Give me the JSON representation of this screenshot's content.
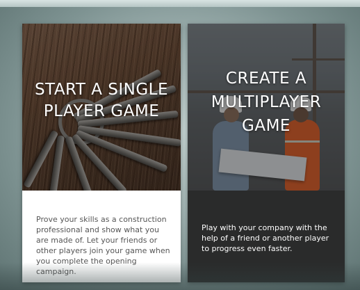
{
  "cards": {
    "single": {
      "title_line1": "START A SINGLE",
      "title_line2": "PLAYER GAME",
      "image_icon": "keys-icon",
      "description": "Prove your skills as a construction professional and show what you are made of. Let your friends or other players join your game when you complete the opening campaign."
    },
    "multi": {
      "title_line1": "CREATE A",
      "title_line2": "MULTIPLAYER",
      "title_line3": "GAME",
      "image_icon": "construction-workers-icon",
      "description": "Play with your company with the help of a friend or another player to progress even faster."
    }
  },
  "colors": {
    "card_single_bg": "#ffffff",
    "card_multi_bg": "#2a2b2b",
    "title_text": "#ffffff",
    "single_desc_text": "#555555",
    "background": "#a3b5b4"
  }
}
